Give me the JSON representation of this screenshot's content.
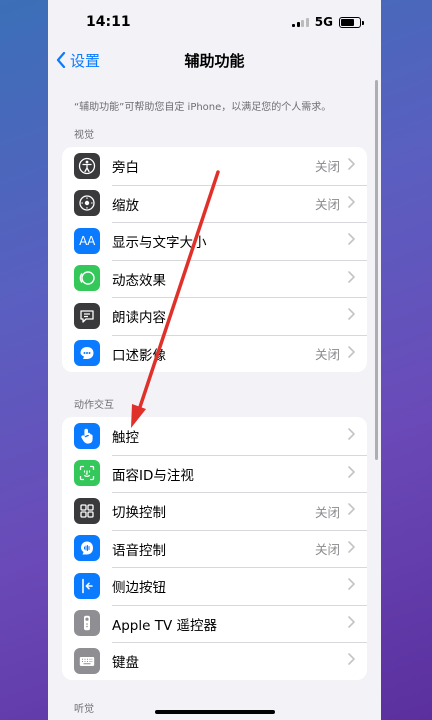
{
  "status": {
    "time": "14:11",
    "network": "5G"
  },
  "nav": {
    "back_label": "设置",
    "title": "辅助功能"
  },
  "description": "“辅助功能”可帮助您自定 iPhone，以满足您的个人需求。",
  "sections": [
    {
      "header": "视觉",
      "rows": [
        {
          "label": "旁白",
          "value": "关闭",
          "icon": "voiceover-icon",
          "color": "#3a3a3c"
        },
        {
          "label": "缩放",
          "value": "关闭",
          "icon": "zoom-icon",
          "color": "#3a3a3c"
        },
        {
          "label": "显示与文字大小",
          "value": "",
          "icon": "text-size-icon",
          "color": "#0a7aff"
        },
        {
          "label": "动态效果",
          "value": "",
          "icon": "motion-icon",
          "color": "#34c759"
        },
        {
          "label": "朗读内容",
          "value": "",
          "icon": "speech-icon",
          "color": "#3a3a3c"
        },
        {
          "label": "口述影像",
          "value": "关闭",
          "icon": "audio-description-icon",
          "color": "#0a7aff"
        }
      ]
    },
    {
      "header": "动作交互",
      "rows": [
        {
          "label": "触控",
          "value": "",
          "icon": "touch-icon",
          "color": "#0a7aff"
        },
        {
          "label": "面容ID与注视",
          "value": "",
          "icon": "face-id-icon",
          "color": "#34c759"
        },
        {
          "label": "切换控制",
          "value": "关闭",
          "icon": "switch-control-icon",
          "color": "#3a3a3c"
        },
        {
          "label": "语音控制",
          "value": "关闭",
          "icon": "voice-control-icon",
          "color": "#0a7aff"
        },
        {
          "label": "侧边按钮",
          "value": "",
          "icon": "side-button-icon",
          "color": "#0a7aff"
        },
        {
          "label": "Apple TV 遥控器",
          "value": "",
          "icon": "remote-icon",
          "color": "#8e8e93"
        },
        {
          "label": "键盘",
          "value": "",
          "icon": "keyboard-icon",
          "color": "#8e8e93"
        }
      ]
    }
  ],
  "bottom_header": "听觉",
  "icon_glyphs": {
    "text_size": "AA"
  },
  "accent_color": "#0a7aff",
  "annotation_color": "#e0302a"
}
